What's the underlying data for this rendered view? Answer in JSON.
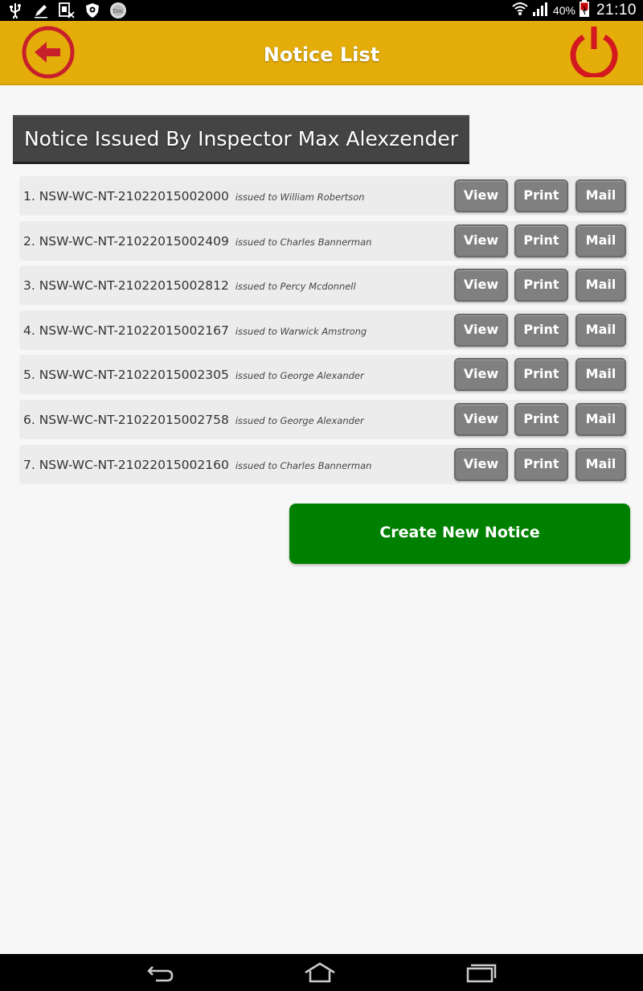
{
  "status_bar": {
    "left_icons": [
      "usb-icon",
      "edit-icon",
      "no-sim-icon",
      "shield-icon",
      "app-icon"
    ],
    "battery": "40%",
    "time": "21:10"
  },
  "app_bar": {
    "title": "Notice List",
    "background_color": "#e4ad0a",
    "back_icon_color": "#c8202a",
    "power_icon_color": "#d41820"
  },
  "section": {
    "header": "Notice Issued By Inspector Max Alexzender"
  },
  "notices": [
    {
      "number": "1. NSW-WC-NT-21022015002000",
      "issued_to": "issued to William Robertson",
      "view": "View",
      "print": "Print",
      "mail": "Mail"
    },
    {
      "number": "2. NSW-WC-NT-21022015002409",
      "issued_to": "issued to Charles Bannerman",
      "view": "View",
      "print": "Print",
      "mail": "Mail"
    },
    {
      "number": "3. NSW-WC-NT-21022015002812",
      "issued_to": "issued to Percy Mcdonnell",
      "view": "View",
      "print": "Print",
      "mail": "Mail"
    },
    {
      "number": "4. NSW-WC-NT-21022015002167",
      "issued_to": "issued to Warwick Amstrong",
      "view": "View",
      "print": "Print",
      "mail": "Mail"
    },
    {
      "number": "5. NSW-WC-NT-21022015002305",
      "issued_to": "issued to George Alexander",
      "view": "View",
      "print": "Print",
      "mail": "Mail"
    },
    {
      "number": "6. NSW-WC-NT-21022015002758",
      "issued_to": "issued to George Alexander",
      "view": "View",
      "print": "Print",
      "mail": "Mail"
    },
    {
      "number": "7. NSW-WC-NT-21022015002160",
      "issued_to": "issued to Charles Bannerman",
      "view": "View",
      "print": "Print",
      "mail": "Mail"
    }
  ],
  "create_button": {
    "label": "Create New Notice",
    "color": "#008000"
  },
  "nav_bar": {
    "buttons": [
      "back-icon",
      "home-icon",
      "recent-apps-icon"
    ]
  }
}
